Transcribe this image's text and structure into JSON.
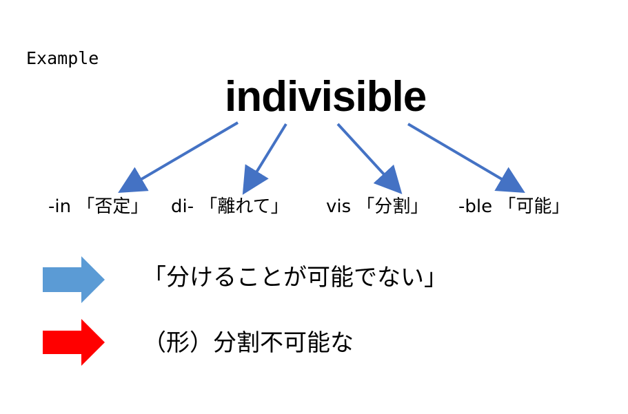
{
  "header": {
    "label": "Example"
  },
  "word": {
    "text": "indivisible"
  },
  "parts": [
    {
      "text": "-in 「否定」"
    },
    {
      "text": "di- 「離れて」"
    },
    {
      "text": "vis 「分割」"
    },
    {
      "text": "-ble 「可能」"
    }
  ],
  "results": {
    "meaning": "「分けることが可能でない」",
    "part_of_speech": "（形）分割不可能な"
  },
  "colors": {
    "connector": "#4472C4",
    "meaning_arrow": "#5B9BD5",
    "pos_arrow": "#FF0000",
    "text": "#000000"
  }
}
